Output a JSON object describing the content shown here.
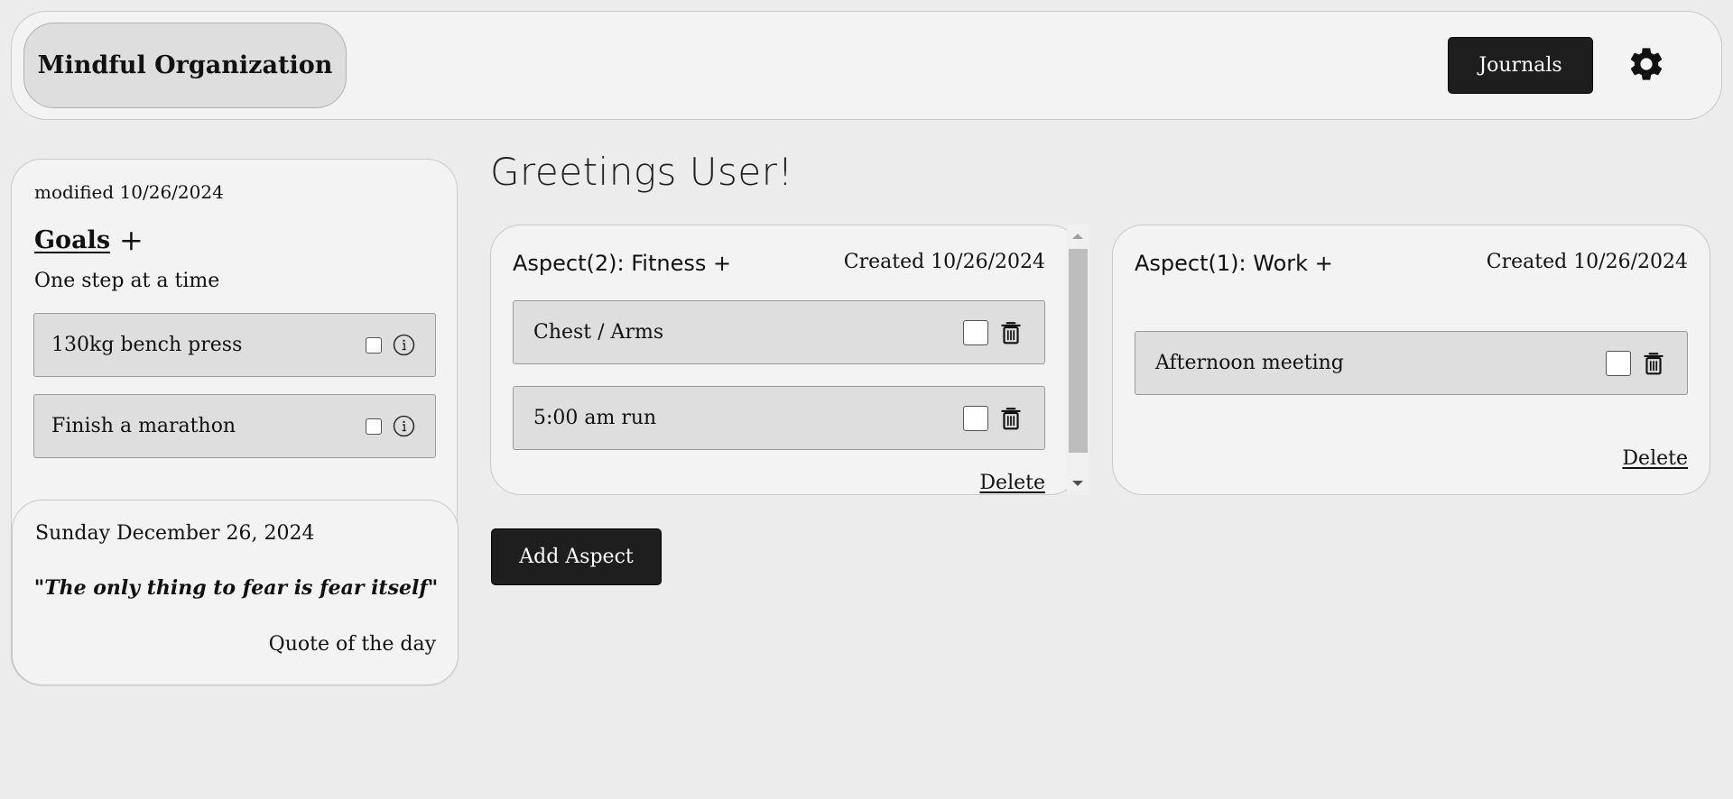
{
  "header": {
    "brand": "Mindful Organization",
    "journals_label": "Journals",
    "settings_icon": "gear-icon"
  },
  "goals": {
    "modified": "modified 10/26/2024",
    "title": "Goals",
    "add_label": "+",
    "motto": "One step at a time",
    "items": [
      {
        "label": "130kg bench press",
        "checked": false
      },
      {
        "label": "Finish a marathon",
        "checked": false
      }
    ]
  },
  "quote": {
    "date": "Sunday December 26, 2024",
    "text": "\"The only thing to fear is fear itself\"",
    "label": "Quote of the day"
  },
  "main": {
    "greeting": "Greetings User!",
    "add_aspect_label": "Add Aspect"
  },
  "aspects": [
    {
      "title": "Aspect(2): Fitness +",
      "created": "Created 10/26/2024",
      "tasks": [
        {
          "label": "Chest / Arms",
          "checked": false
        },
        {
          "label": "5:00 am run",
          "checked": false
        }
      ],
      "delete_label": "Delete"
    },
    {
      "title": "Aspect(1): Work +",
      "created": "Created 10/26/2024",
      "tasks": [
        {
          "label": "Afternoon meeting",
          "checked": false
        }
      ],
      "delete_label": "Delete"
    }
  ],
  "colors": {
    "background": "#ececec",
    "panel": "#f3f3f3",
    "item": "#dedede",
    "button_dark": "#1e1e1e"
  }
}
